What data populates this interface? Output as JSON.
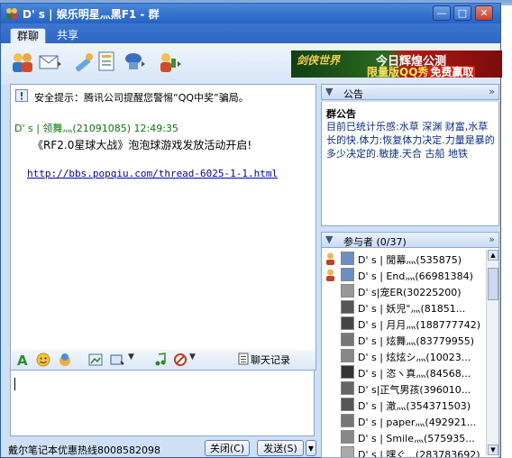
{
  "window": {
    "title": "D' s | 娱乐明星灬黑F1 - 群",
    "minimize": "—",
    "maximize": "□",
    "close": "✕"
  },
  "tabs": [
    {
      "label": "群聊",
      "active": true
    },
    {
      "label": "共享",
      "active": false
    }
  ],
  "banner": {
    "logo": "剑侠世界",
    "line1": "今日辉煌公测",
    "line2a": "限量版QQ秀",
    "line2b": "免费赢取"
  },
  "chat": {
    "security_tip": "安全提示：腾讯公司提醒您警惕“QQ中奖”骗局。",
    "message": {
      "header": "D' s | 领舞灬(21091085) 12:49:35",
      "text": "《RF2.0星球大战》泡泡球游戏发放活动开启!",
      "link": "http://bbs.popqiu.com/thread-6025-1-1.html"
    }
  },
  "format_bar": {
    "history_label": "聊天记录"
  },
  "footer": {
    "ad_text": "戴尔笔记本优惠热线8008582098",
    "close_label": "关闭(C)",
    "send_label": "发送(S)"
  },
  "announcement": {
    "header": "公告",
    "title": "群公告",
    "body": "目前已统计乐感:水草 深渊  财富,水草长的快.体力:恢复体力决定.力量是暴的多少决定的.敏捷.天合 古船 地铁"
  },
  "members": {
    "header": "参与者 (0/37)",
    "list": [
      "D' s | 閒幕灬(535875)",
      "D' s | End灬(66981384)",
      "D' s|宠ER(30225200)",
      "D' s | 妖児\"灬(81851...",
      "D' s | 月月灬(188777742)",
      "D' s | 炫舞灬(83779955)",
      "D' s | 炫炫シ灬(10023...",
      "D' s | 恣ヽ真灬(84568...",
      "D' s|正气男孩(396010...",
      "D' s |  澈灬(354371503)",
      "D' s | paper灬(492921...",
      "D' s | Smile灬(575935...",
      "D' s | 嘿ぐ...(283783692)"
    ]
  }
}
